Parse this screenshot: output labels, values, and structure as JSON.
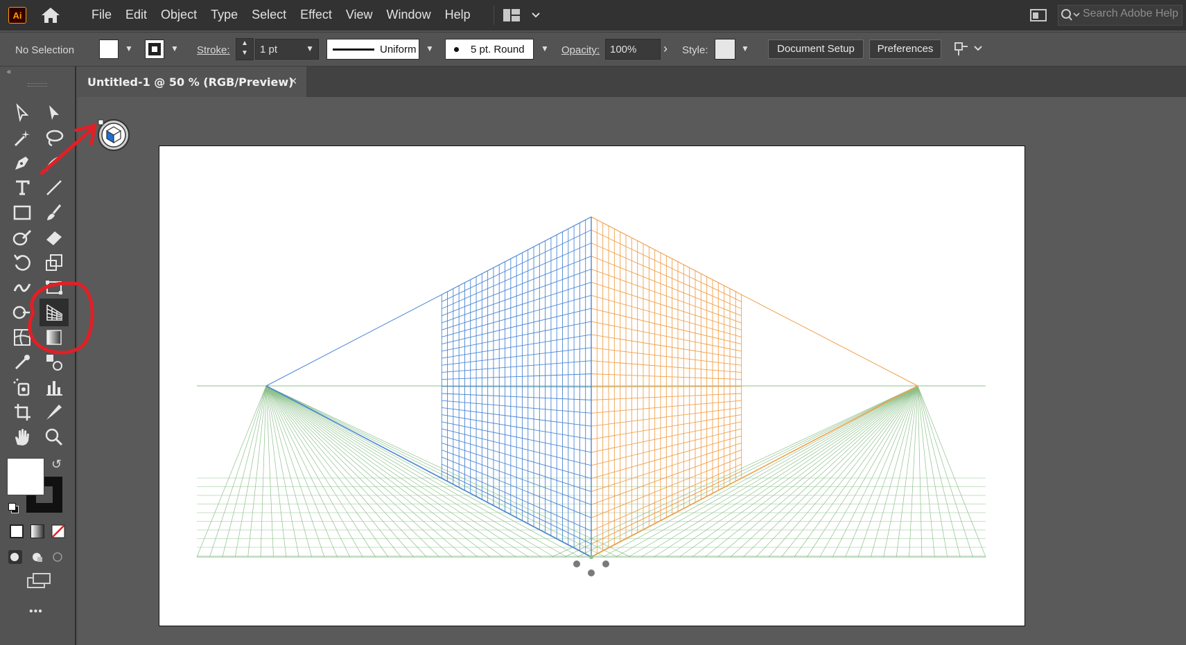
{
  "app": {
    "logo": "Ai"
  },
  "menu": [
    "File",
    "Edit",
    "Object",
    "Type",
    "Select",
    "Effect",
    "View",
    "Window",
    "Help"
  ],
  "search": {
    "placeholder": "Search Adobe Help"
  },
  "control": {
    "selection": "No Selection",
    "stroke_label": "Stroke:",
    "stroke_weight": "1 pt",
    "profile": "Uniform",
    "brush": "5 pt. Round",
    "opacity_label": "Opacity:",
    "opacity": "100%",
    "style_label": "Style:",
    "document_setup": "Document Setup",
    "preferences": "Preferences"
  },
  "document": {
    "tab_title": "Untitled-1 @ 50 % (RGB/Preview)",
    "close": "×"
  },
  "toolbar": {
    "more": "•••"
  },
  "colors": {
    "left_plane": "#4a86d4",
    "right_plane": "#f0a04b",
    "ground": "#8cc08a",
    "annotation": "#e21f26"
  }
}
